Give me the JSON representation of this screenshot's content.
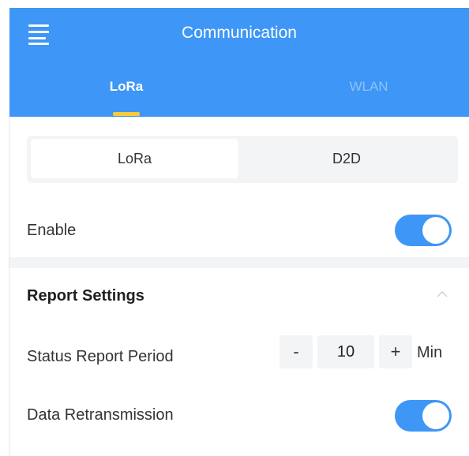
{
  "header": {
    "title": "Communication",
    "menu_icon": "hamburger-menu-icon",
    "tabs": [
      {
        "label": "LoRa",
        "active": true
      },
      {
        "label": "WLAN",
        "active": false
      }
    ],
    "color": "#3e96f6",
    "indicator_color": "#f7cb3b"
  },
  "segment": {
    "options": [
      {
        "label": "LoRa",
        "selected": true
      },
      {
        "label": "D2D",
        "selected": false
      }
    ]
  },
  "enable": {
    "label": "Enable",
    "on": true
  },
  "report_settings": {
    "title": "Report Settings",
    "collapse_icon": "chevron-up-icon",
    "status_report_period": {
      "label": "Status Report Period",
      "minus_label": "-",
      "value": "10",
      "plus_label": "+",
      "unit": "Min"
    },
    "data_retransmission": {
      "label": "Data Retransmission",
      "on": true
    }
  }
}
